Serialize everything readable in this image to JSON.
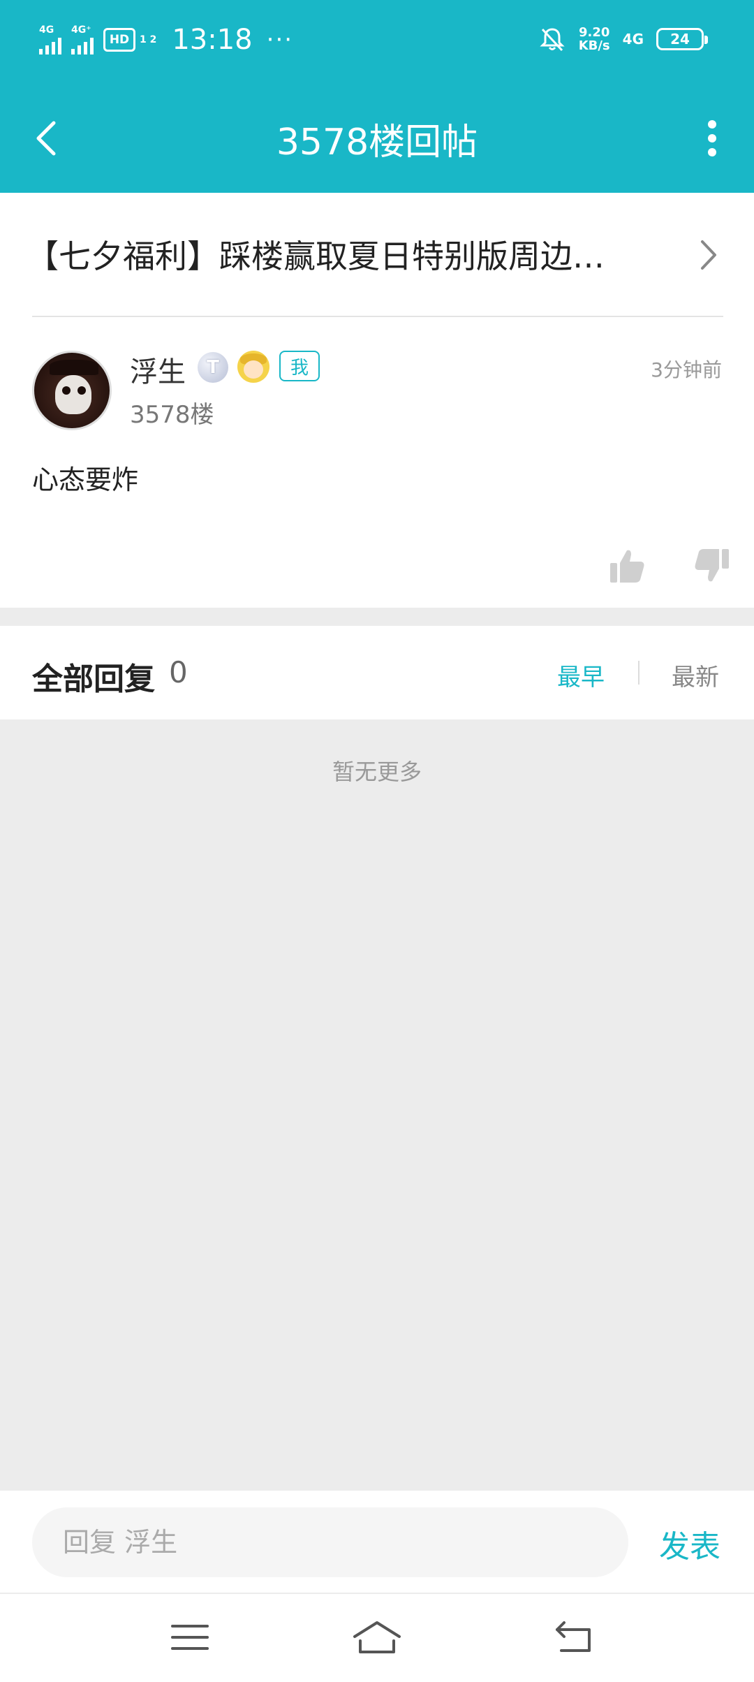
{
  "status_bar": {
    "signal1_label": "4G",
    "signal2_label": "4G⁺",
    "hd_label": "HD",
    "hd_sub": "1 2",
    "time": "13:18",
    "more": "···",
    "net_speed_value": "9.20",
    "net_speed_unit": "KB/s",
    "network_type": "4G",
    "battery": "24"
  },
  "app_bar": {
    "title": "3578楼回帖"
  },
  "post": {
    "thread_title": "【七夕福利】踩楼赢取夏日特别版周边…",
    "author": "浮生",
    "level_badge": "T",
    "me_badge": "我",
    "floor": "3578楼",
    "time": "3分钟前",
    "content": "心态要炸"
  },
  "replies": {
    "header": "全部回复",
    "count": "0",
    "sort_earliest": "最早",
    "sort_latest": "最新",
    "empty_text": "暂无更多"
  },
  "compose": {
    "placeholder": "回复 浮生",
    "submit_label": "发表"
  },
  "colors": {
    "accent": "#19b7c7",
    "background": "#ececec"
  }
}
